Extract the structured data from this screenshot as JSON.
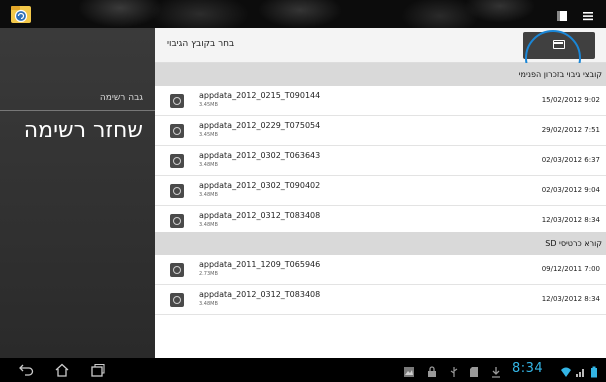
{
  "header": {
    "title": "בחר בקובץ הגיבוי"
  },
  "left_panel": {
    "subtitle": "גבה רשימה",
    "title": "שחזר רשימה"
  },
  "sections": [
    {
      "label": "קובצי גיבוי בזכרון הפנימי",
      "files": [
        {
          "name": "appdata_2012_0215_T090144",
          "size": "3.45MB",
          "date": "15/02/2012 9:02"
        },
        {
          "name": "appdata_2012_0229_T075054",
          "size": "3.45MB",
          "date": "29/02/2012 7:51"
        },
        {
          "name": "appdata_2012_0302_T063643",
          "size": "3.48MB",
          "date": "02/03/2012 6:37"
        },
        {
          "name": "appdata_2012_0302_T090402",
          "size": "3.48MB",
          "date": "02/03/2012 9:04"
        },
        {
          "name": "appdata_2012_0312_T083408",
          "size": "3.48MB",
          "date": "12/03/2012 8:34"
        }
      ]
    },
    {
      "label": "קורא כרטיסי SD",
      "files": [
        {
          "name": "appdata_2011_1209_T065946",
          "size": "2.73MB",
          "date": "09/12/2011 7:00"
        },
        {
          "name": "appdata_2012_0312_T083408",
          "size": "3.48MB",
          "date": "12/03/2012 8:34"
        }
      ]
    }
  ],
  "system_bar": {
    "clock": "8:34"
  },
  "colors": {
    "accent": "#1a86d6",
    "clock": "#33b5e5",
    "section_bg": "#d9d9d9",
    "panel_bg": "#2e2e2e"
  },
  "icons": [
    "app-icon",
    "window-icon",
    "menu-icon",
    "folder-icon",
    "file-icon",
    "back-icon",
    "home-icon",
    "recent-apps-icon",
    "gallery-icon",
    "lock-icon",
    "usb-icon",
    "sd-icon",
    "download-icon",
    "wifi-icon",
    "battery-icon"
  ]
}
